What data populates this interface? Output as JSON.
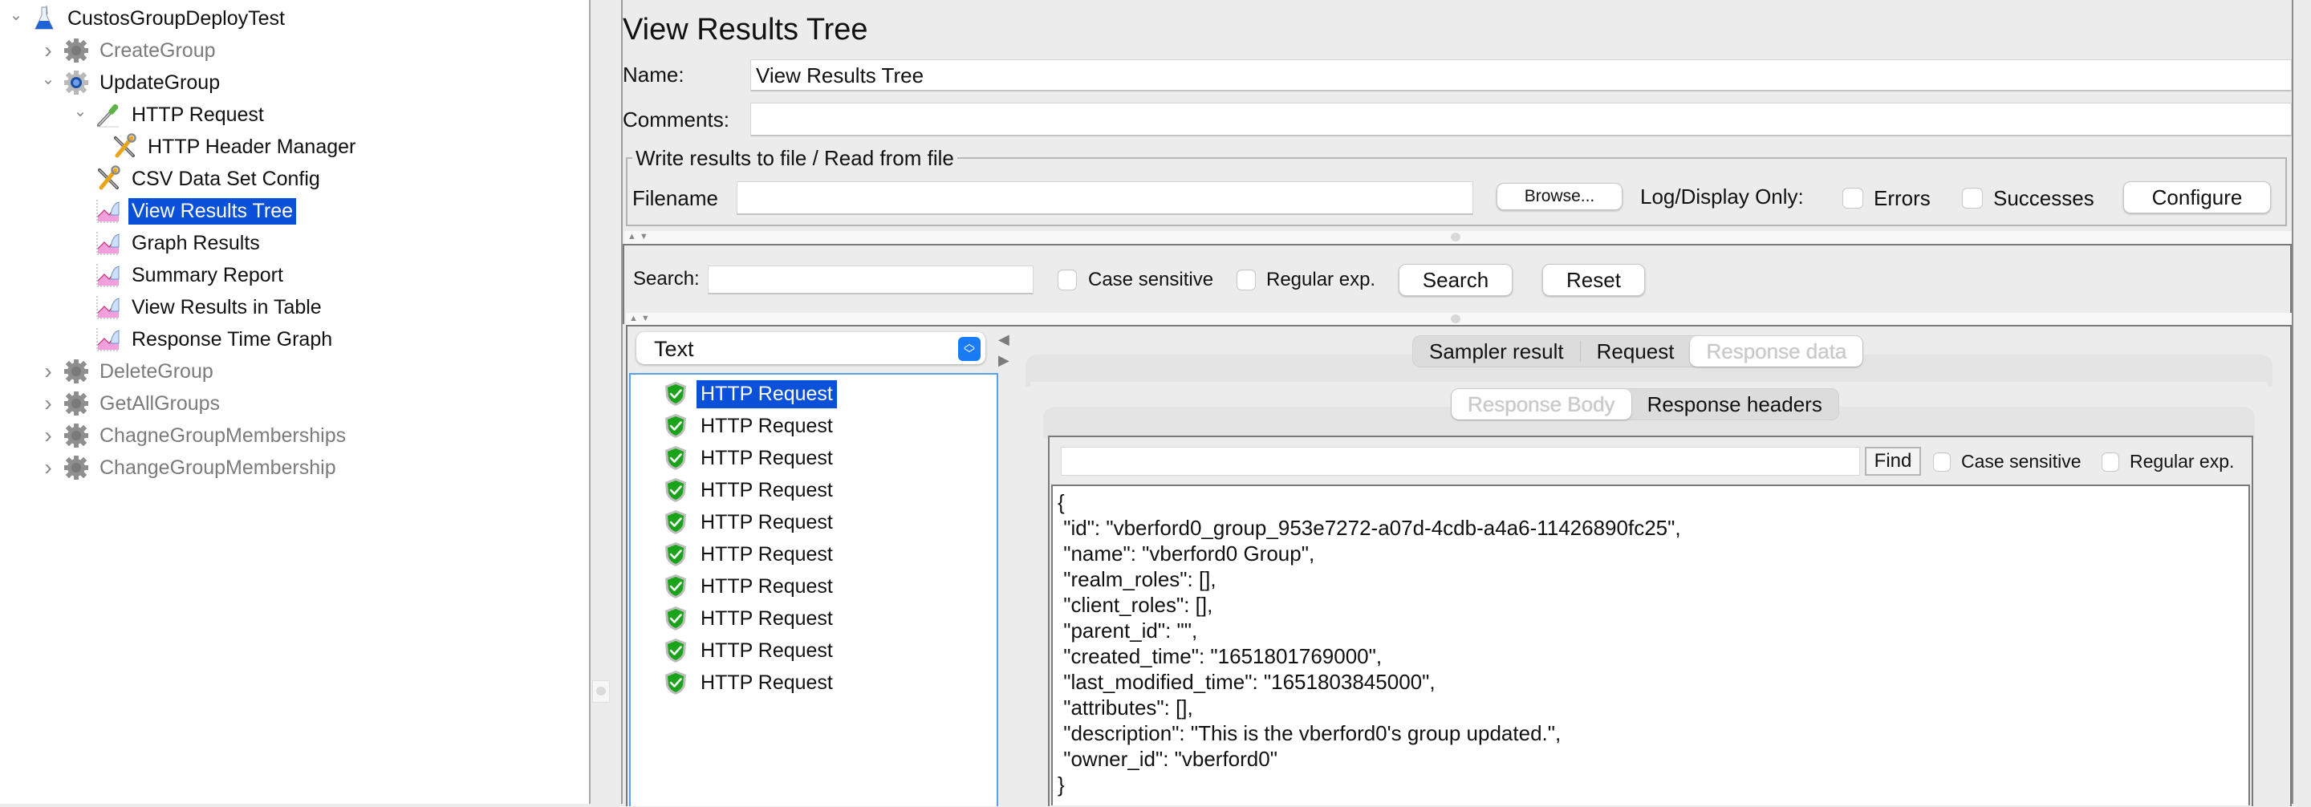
{
  "tree": {
    "items": [
      {
        "label": "CustosGroupDeployTest",
        "icon": "test-plan-flask-icon",
        "chevron": "expanded",
        "state": "normal"
      },
      {
        "label": "CreateGroup",
        "icon": "thread-group-gear-icon",
        "chevron": "collapsed",
        "state": "disabled"
      },
      {
        "label": "UpdateGroup",
        "icon": "thread-group-gear-icon",
        "chevron": "expanded",
        "state": "normal"
      },
      {
        "label": "HTTP Request",
        "icon": "http-sampler-pipette-icon",
        "chevron": "expanded",
        "state": "normal"
      },
      {
        "label": "HTTP Header Manager",
        "icon": "config-wrench-icon",
        "chevron": "none",
        "state": "normal"
      },
      {
        "label": "CSV Data Set Config",
        "icon": "config-wrench-icon",
        "chevron": "none",
        "state": "normal"
      },
      {
        "label": "View Results Tree",
        "icon": "listener-graph-icon",
        "chevron": "none",
        "state": "selected"
      },
      {
        "label": "Graph Results",
        "icon": "listener-graph-icon",
        "chevron": "none",
        "state": "normal"
      },
      {
        "label": "Summary Report",
        "icon": "listener-graph-icon",
        "chevron": "none",
        "state": "normal"
      },
      {
        "label": "View Results in Table",
        "icon": "listener-graph-icon",
        "chevron": "none",
        "state": "normal"
      },
      {
        "label": "Response Time Graph",
        "icon": "listener-graph-icon",
        "chevron": "none",
        "state": "normal"
      },
      {
        "label": "DeleteGroup",
        "icon": "thread-group-gear-icon",
        "chevron": "collapsed",
        "state": "disabled"
      },
      {
        "label": "GetAllGroups",
        "icon": "thread-group-gear-icon",
        "chevron": "collapsed",
        "state": "disabled"
      },
      {
        "label": "ChagneGroupMemberships",
        "icon": "thread-group-gear-icon",
        "chevron": "collapsed",
        "state": "disabled"
      },
      {
        "label": "ChangeGroupMembership",
        "icon": "thread-group-gear-icon",
        "chevron": "collapsed",
        "state": "disabled"
      }
    ]
  },
  "panel": {
    "title": "View Results Tree",
    "name_label": "Name:",
    "name_value": "View Results Tree",
    "comments_label": "Comments:",
    "comments_value": "",
    "file_group_title": "Write results to file / Read from file",
    "filename_label": "Filename",
    "filename_value": "",
    "browse_button": "Browse...",
    "log_display_label": "Log/Display Only:",
    "errors_label": "Errors",
    "errors_checked": false,
    "successes_label": "Successes",
    "successes_checked": false,
    "configure_button": "Configure"
  },
  "search": {
    "label": "Search:",
    "value": "",
    "case_sensitive_label": "Case sensitive",
    "case_sensitive_checked": false,
    "regex_label": "Regular exp.",
    "regex_checked": false,
    "search_button": "Search",
    "reset_button": "Reset"
  },
  "results": {
    "renderer_selected": "Text",
    "items": [
      {
        "label": "HTTP Request",
        "status": "success",
        "selected": true
      },
      {
        "label": "HTTP Request",
        "status": "success",
        "selected": false
      },
      {
        "label": "HTTP Request",
        "status": "success",
        "selected": false
      },
      {
        "label": "HTTP Request",
        "status": "success",
        "selected": false
      },
      {
        "label": "HTTP Request",
        "status": "success",
        "selected": false
      },
      {
        "label": "HTTP Request",
        "status": "success",
        "selected": false
      },
      {
        "label": "HTTP Request",
        "status": "success",
        "selected": false
      },
      {
        "label": "HTTP Request",
        "status": "success",
        "selected": false
      },
      {
        "label": "HTTP Request",
        "status": "success",
        "selected": false
      },
      {
        "label": "HTTP Request",
        "status": "success",
        "selected": false
      }
    ]
  },
  "detail": {
    "tabs": [
      {
        "label": "Sampler result",
        "active": false
      },
      {
        "label": "Request",
        "active": false
      },
      {
        "label": "Response data",
        "active": true
      }
    ],
    "subtabs": [
      {
        "label": "Response Body",
        "active": true
      },
      {
        "label": "Response headers",
        "active": false
      }
    ],
    "find_value": "",
    "find_button": "Find",
    "case_sensitive_label": "Case sensitive",
    "case_sensitive_checked": false,
    "regex_label": "Regular exp.",
    "regex_checked": false,
    "response_lines": [
      "{",
      " \"id\": \"vberford0_group_953e7272-a07d-4cdb-a4a6-11426890fc25\",",
      " \"name\": \"vberford0 Group\",",
      " \"realm_roles\": [],",
      " \"client_roles\": [],",
      " \"parent_id\": \"\",",
      " \"created_time\": \"1651801769000\",",
      " \"last_modified_time\": \"1651803845000\",",
      " \"attributes\": [],",
      " \"description\": \"This is the vberford0's group updated.\",",
      " \"owner_id\": \"vberford0\"",
      "}"
    ]
  },
  "colors": {
    "selection": "#0a50d8",
    "list_focus_border": "#5aa0e6",
    "combo_stepper": "#1a7cf5",
    "success_shield": "#1aa31a",
    "disabled_text": "#7b7b7b"
  }
}
